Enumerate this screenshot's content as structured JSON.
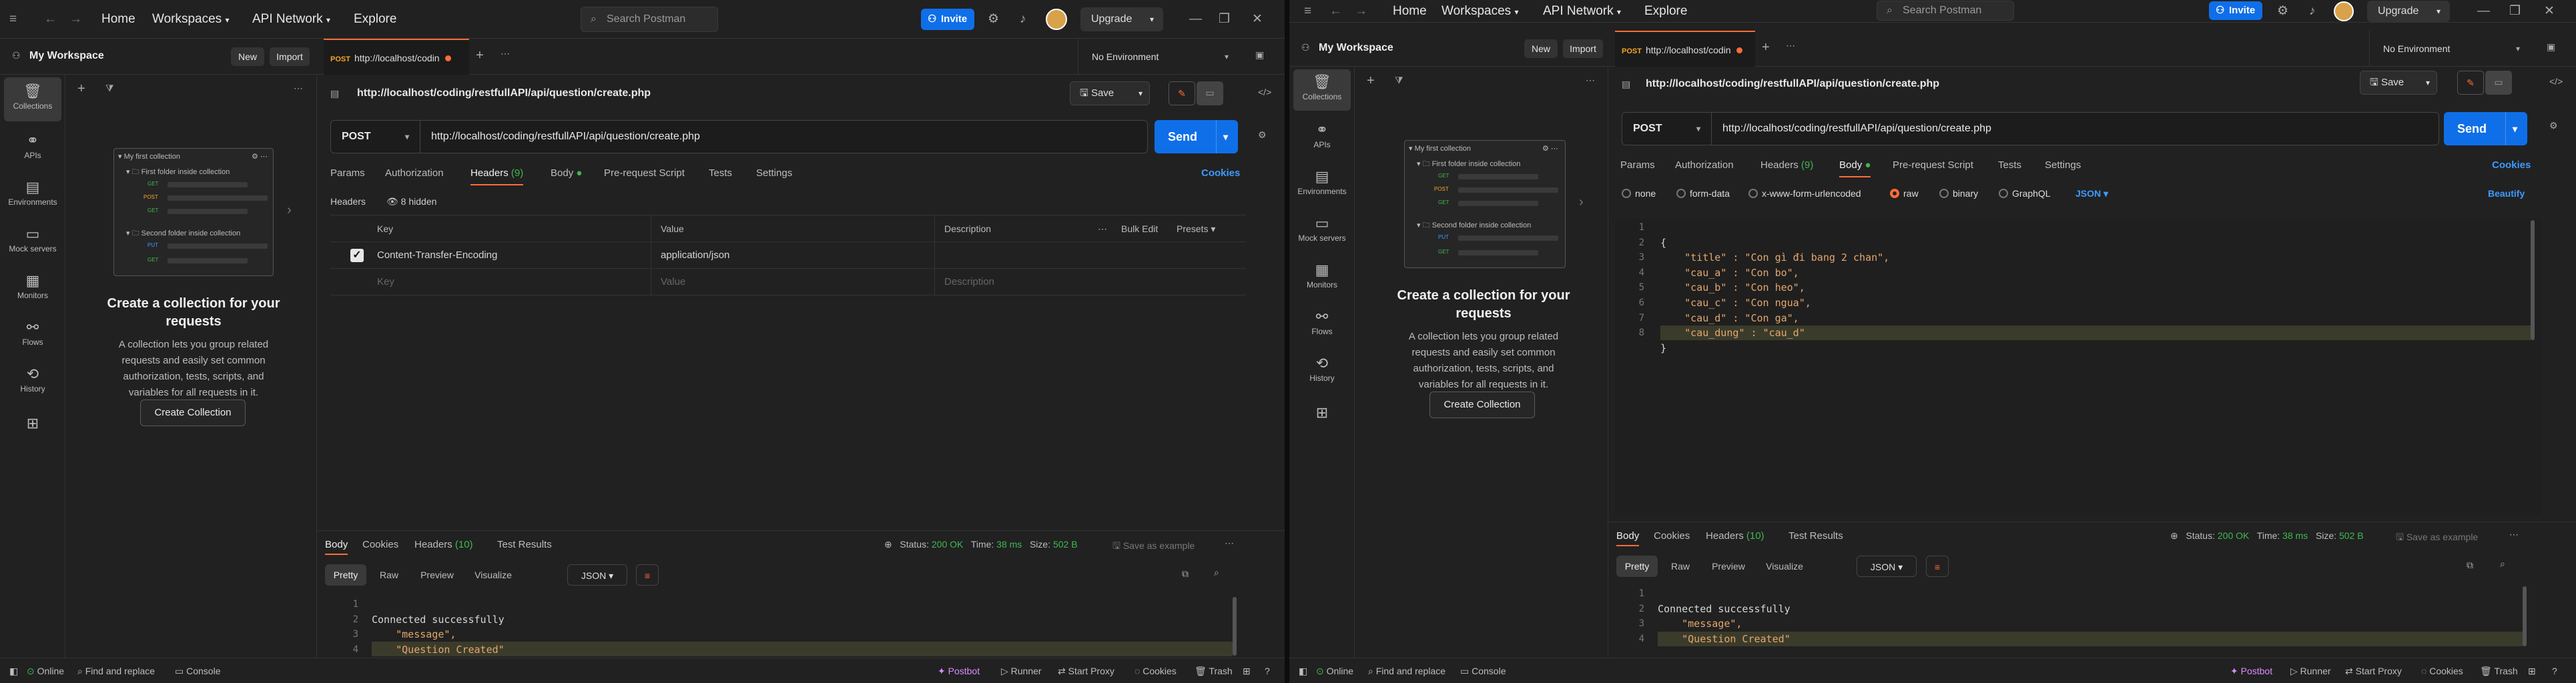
{
  "titlebar": {
    "nav": [
      "Home",
      "Workspaces",
      "API Network",
      "Explore"
    ],
    "search_placeholder": "Search Postman",
    "invite": "Invite",
    "upgrade": "Upgrade"
  },
  "sidebar": {
    "workspace": "My Workspace",
    "new": "New",
    "import": "Import",
    "rail": [
      "Collections",
      "APIs",
      "Environments",
      "Mock servers",
      "Monitors",
      "Flows",
      "History"
    ],
    "illustration": {
      "root": "My first collection",
      "folder1": "First folder inside collection",
      "folder2": "Second folder inside collection",
      "methods": [
        "GET",
        "POST",
        "PUT"
      ]
    },
    "empty_title": "Create a collection for your requests",
    "empty_desc": "A collection lets you group related requests and easily set common authorization, tests, scripts, and variables for all requests in it.",
    "create_btn": "Create Collection"
  },
  "request": {
    "tab_method": "POST",
    "tab_label": "http://localhost/codin",
    "env": "No Environment",
    "title": "http://localhost/coding/restfullAPI/api/question/create.php",
    "save": "Save",
    "method": "POST",
    "url": "http://localhost/coding/restfullAPI/api/question/create.php",
    "send": "Send",
    "tabs_left": [
      "Params",
      "Authorization",
      "Headers",
      "(9)",
      "Body",
      "Pre-request Script",
      "Tests",
      "Settings"
    ],
    "cookies": "Cookies"
  },
  "left_window": {
    "headers_label": "Headers",
    "hidden": "8 hidden",
    "table_head": [
      "Key",
      "Value",
      "Description",
      "Bulk Edit",
      "Presets"
    ],
    "row_key": "Content-Transfer-Encoding",
    "row_value": "application/json",
    "empty_key": "Key",
    "empty_value": "Value",
    "empty_desc": "Description"
  },
  "right_window": {
    "body_options": [
      "none",
      "form-data",
      "x-www-form-urlencoded",
      "raw",
      "binary",
      "GraphQL"
    ],
    "body_format": "JSON",
    "beautify": "Beautify",
    "body_lines": [
      "{",
      "    \"title\" : \"Con gì đi bang 2 chan\",",
      "    \"cau_a\" : \"Con bo\",",
      "    \"cau_b\" : \"Con heo\",",
      "    \"cau_c\" : \"Con ngua\",",
      "    \"cau_d\" : \"Con ga\",",
      "    \"cau_dung\" : \"cau_d\"",
      "}"
    ]
  },
  "response": {
    "tabs": [
      "Body",
      "Cookies",
      "Headers",
      "(10)",
      "Test Results"
    ],
    "status_label": "Status:",
    "status": "200 OK",
    "time_label": "Time:",
    "time": "38 ms",
    "size_label": "Size:",
    "size": "502 B",
    "save_example": "Save as example",
    "views": [
      "Pretty",
      "Raw",
      "Preview",
      "Visualize"
    ],
    "format": "JSON",
    "lines": [
      "Connected successfully",
      "    \"message\",",
      "    \"Question Created\"",
      ""
    ]
  },
  "statusbar": {
    "left": [
      "Online",
      "Find and replace",
      "Console"
    ],
    "right": [
      "Postbot",
      "Runner",
      "Start Proxy",
      "Cookies",
      "Trash"
    ]
  }
}
